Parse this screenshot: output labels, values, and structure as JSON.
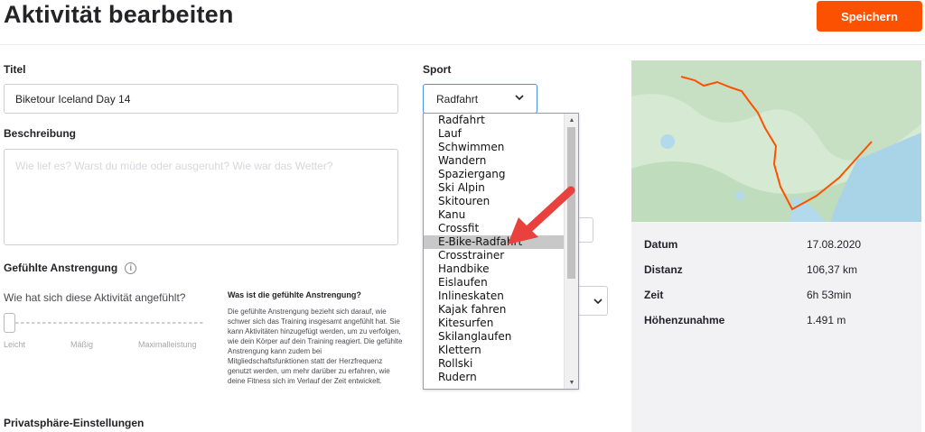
{
  "header": {
    "title": "Aktivität bearbeiten",
    "save_label": "Speichern"
  },
  "form": {
    "title_label": "Titel",
    "title_value": "Biketour Iceland Day 14",
    "description_label": "Beschreibung",
    "description_placeholder": "Wie lief es? Warst du müde oder ausgeruht? Wie war das Wetter?",
    "effort_label": "Gefühlte Anstrengung",
    "effort_question": "Wie hat sich diese Aktivität angefühlt?",
    "effort_value": 0,
    "scale": [
      "Leicht",
      "Mäßig",
      "Maximalleistung"
    ],
    "help_title": "Was ist die gefühlte Anstrengung?",
    "help_text": "Die gefühlte Anstrengung bezieht sich darauf, wie schwer sich das Training insgesamt angefühlt hat. Sie kann Aktivitäten hinzugefügt werden, um zu verfolgen, wie dein Körper auf dein Training reagiert. Die gefühlte Anstrengung kann zudem bei Mitgliedschaftsfunktionen statt der Herzfrequenz genutzt werden, um mehr darüber zu erfahren, wie deine Fitness sich im Verlauf der Zeit entwickelt.",
    "privacy_label": "Privatsphäre-Einstellungen",
    "sport_label": "Sport",
    "sport_value": "Radfahrt"
  },
  "sport_options": [
    "Radfahrt",
    "Lauf",
    "Schwimmen",
    "Wandern",
    "Spaziergang",
    "Ski Alpin",
    "Skitouren",
    "Kanu",
    "Crossfit",
    "E-Bike-Radfahrt",
    "Crosstrainer",
    "Handbike",
    "Eislaufen",
    "Inlineskaten",
    "Kajak fahren",
    "Kitesurfen",
    "Skilanglaufen",
    "Klettern",
    "Rollski",
    "Rudern"
  ],
  "highlighted_option": "E-Bike-Radfahrt",
  "stats": [
    {
      "label": "Datum",
      "value": "17.08.2020"
    },
    {
      "label": "Distanz",
      "value": "106,37 km"
    },
    {
      "label": "Zeit",
      "value": "6h 53min"
    },
    {
      "label": "Höhenzunahme",
      "value": "1.491 m"
    }
  ],
  "colors": {
    "accent": "#fc5200",
    "arrow": "#e8413e",
    "route": "#fc5200"
  },
  "icons": {
    "info": "info-icon",
    "chevron": "chevron-down-icon",
    "scroll_up": "scroll-up-icon",
    "scroll_down": "scroll-down-icon"
  }
}
